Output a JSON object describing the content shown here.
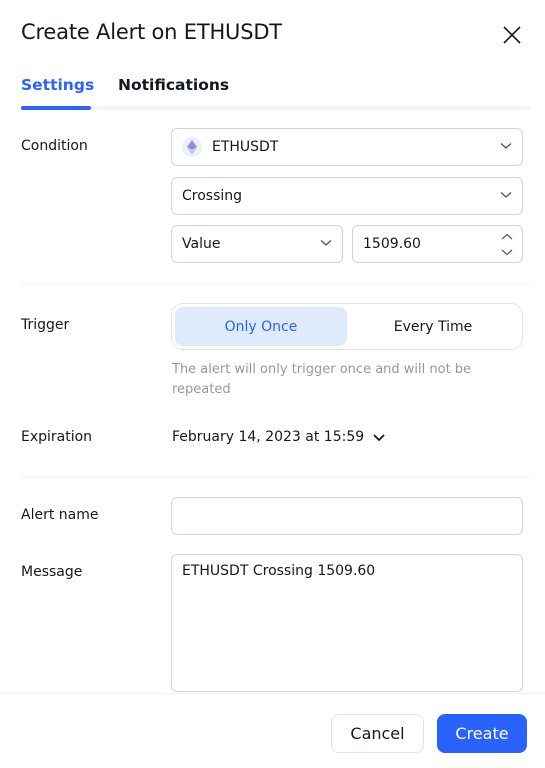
{
  "dialog": {
    "title": "Create Alert on ETHUSDT",
    "close_icon": "close-icon"
  },
  "tabs": [
    {
      "label": "Settings",
      "active": true
    },
    {
      "label": "Notifications",
      "active": false
    }
  ],
  "condition": {
    "label": "Condition",
    "symbol": {
      "value": "ETHUSDT",
      "icon": "ethereum-icon"
    },
    "operator": {
      "value": "Crossing"
    },
    "target_type": {
      "value": "Value"
    },
    "target_value": {
      "value": "1509.60"
    }
  },
  "trigger": {
    "label": "Trigger",
    "options": [
      {
        "label": "Only Once",
        "selected": true
      },
      {
        "label": "Every Time",
        "selected": false
      }
    ],
    "hint": "The alert will only trigger once and will not be repeated"
  },
  "expiration": {
    "label": "Expiration",
    "value": "February 14, 2023 at 15:59"
  },
  "alert_name": {
    "label": "Alert name",
    "value": ""
  },
  "message": {
    "label": "Message",
    "value": "ETHUSDT Crossing 1509.60"
  },
  "footer": {
    "cancel_label": "Cancel",
    "create_label": "Create"
  },
  "colors": {
    "accent": "#2962ff",
    "accent_light": "#dfeafd",
    "text": "#131722",
    "hint": "#9598a1",
    "border": "#d1d4dc"
  }
}
